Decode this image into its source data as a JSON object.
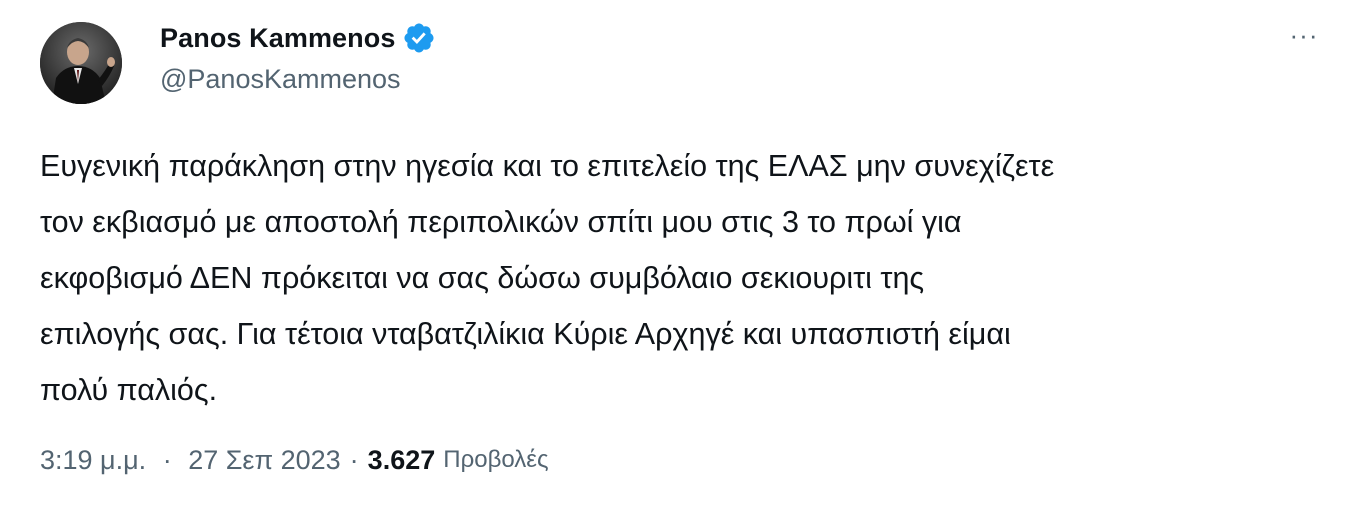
{
  "author": {
    "display_name": "Panos Kammenos",
    "handle": "@PanosKammenos",
    "verified": true,
    "verified_color": "#1d9bf0"
  },
  "menu": {
    "more_label": "···"
  },
  "tweet": {
    "text": "Ευγενική παράκληση στην ηγεσία και το επιτελείο της ΕΛΑΣ μην συνεχίζετε\nτον εκβιασμό με αποστολή περιπολικών σπίτι μου στις 3 το πρωί για\nεκφοβισμό ΔΕΝ πρόκειται να σας δώσω συμβόλαιο σεκιουριτι της\nεπιλογής σας. Για τέτοια νταβατζιλίκια Κύριε Αρχηγέ και υπασπιστή είμαι\nπολύ παλιός."
  },
  "meta": {
    "time": "3:19 μ.μ.",
    "separator": "·",
    "date": "27 Σεπ 2023",
    "views_count": "3.627",
    "views_label": "Προβολές"
  }
}
